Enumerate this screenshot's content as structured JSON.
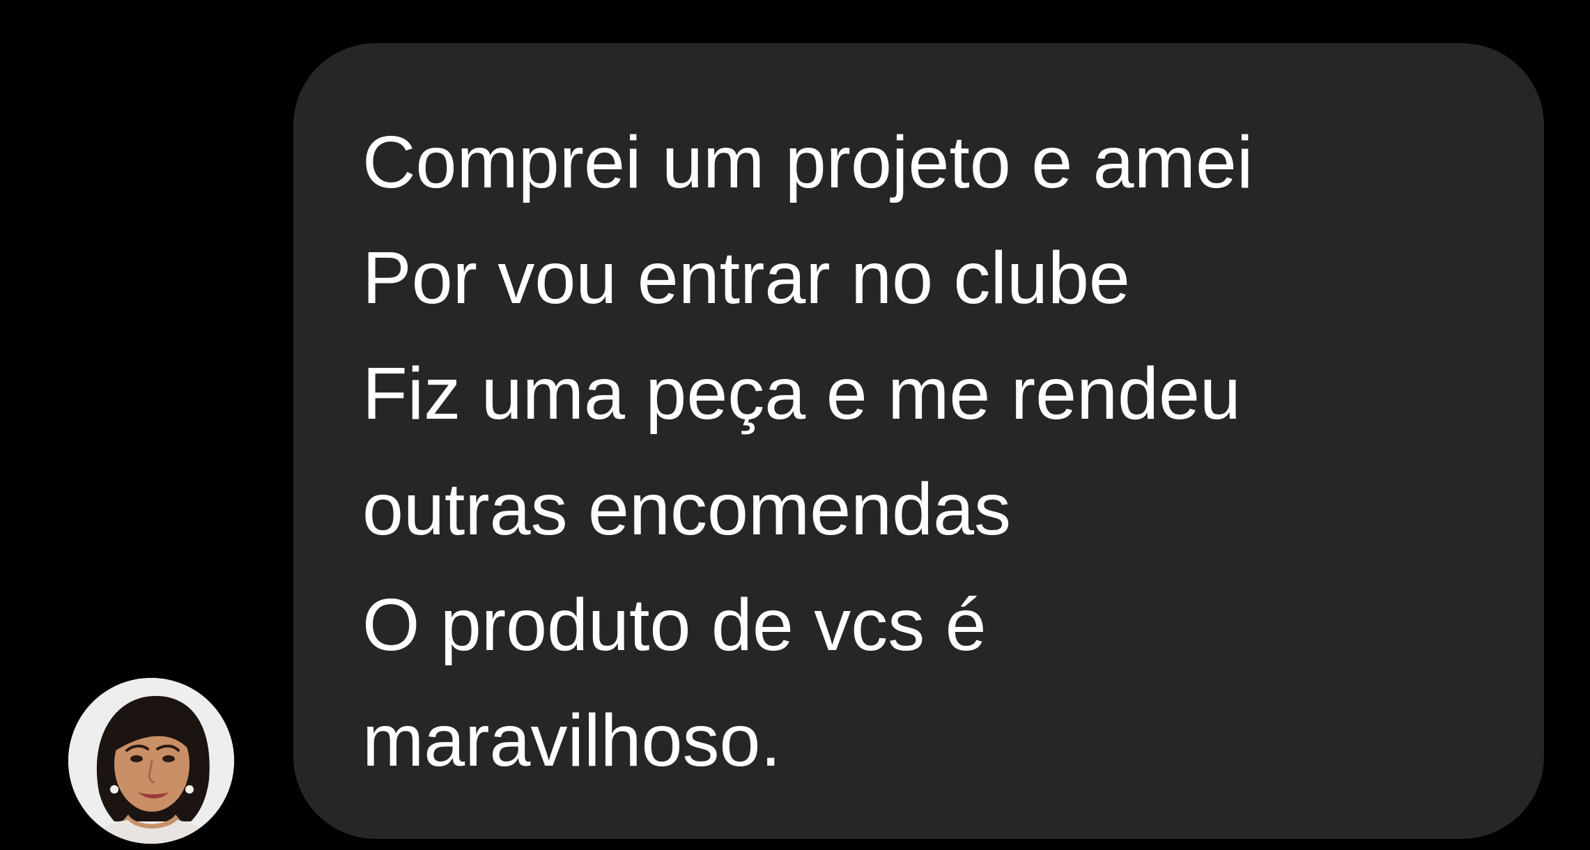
{
  "chat": {
    "message": {
      "lines": [
        "Comprei um projeto e amei",
        "Por vou entrar no clube",
        "Fiz uma peça e me rendeu",
        "outras encomendas",
        "O produto de vcs é",
        "maravilhoso."
      ]
    },
    "sender": {
      "avatar_icon": "profile-photo"
    }
  },
  "colors": {
    "background": "#000000",
    "bubble": "#262626",
    "text": "#ffffff"
  }
}
